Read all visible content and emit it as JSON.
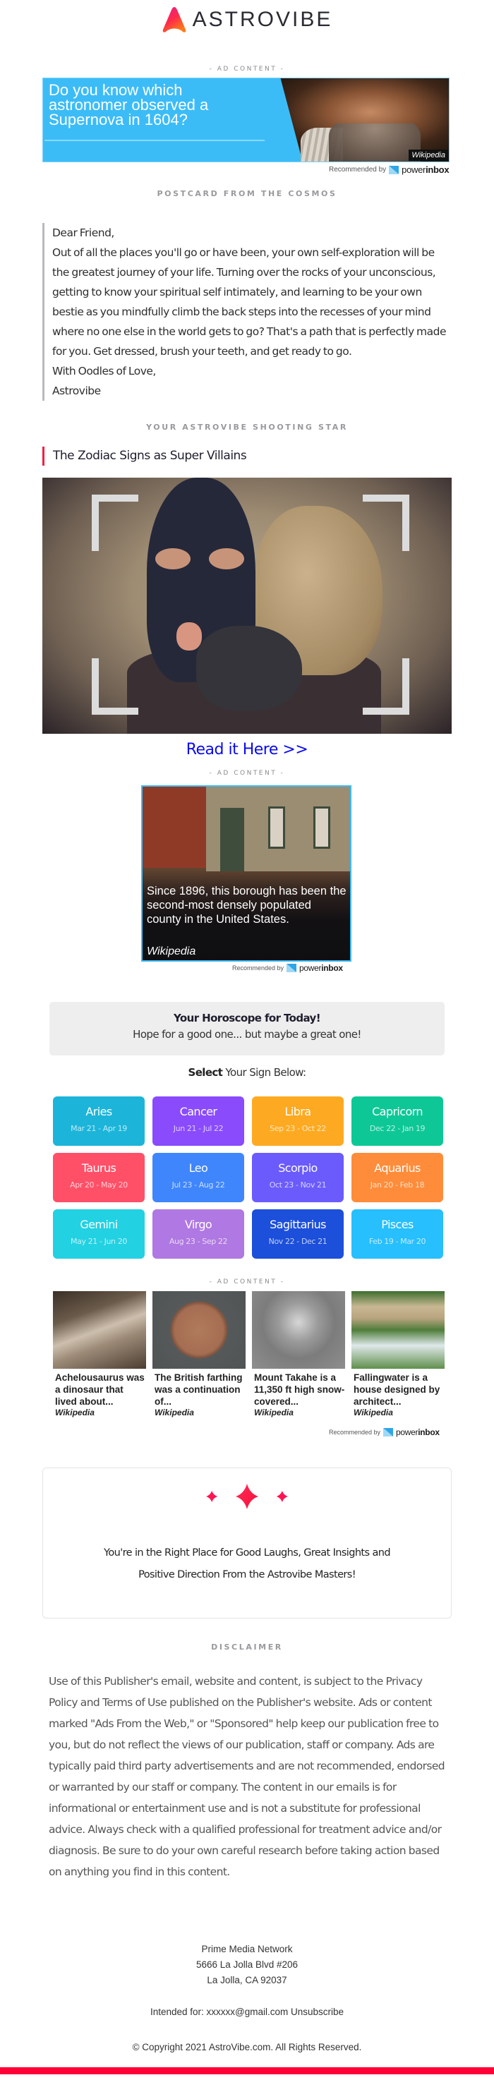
{
  "brand": {
    "name": "ASTROVIBE",
    "logo_icon": "astrovibe-peak-logo",
    "accent_color": "#ff0037"
  },
  "ads": {
    "label": "- AD CONTENT -",
    "recommended_by": "Recommended by",
    "powerinbox_prefix": "power",
    "powerinbox_suffix": "inbox",
    "top_ad": {
      "text": "Do you know which astronomer observed a Supernova in 1604?",
      "source": "Wikipedia",
      "bg_color": "#3cbcf7"
    },
    "middle_ad": {
      "text": "Since 1896, this borough has been the second-most densely populated county in the United States.",
      "source": "Wikipedia"
    },
    "row_ads": [
      {
        "title": "Achelousaurus was a dinosaur that lived about...",
        "source": "Wikipedia"
      },
      {
        "title": "The British farthing was a continuation of...",
        "source": "Wikipedia"
      },
      {
        "title": "Mount Takahe is a 11,350 ft high snow-covered...",
        "source": "Wikipedia"
      },
      {
        "title": "Fallingwater is a house designed by architect...",
        "source": "Wikipedia"
      }
    ]
  },
  "postcard": {
    "section_title": "POSTCARD FROM THE COSMOS",
    "greeting": "Dear Friend,",
    "body": "Out of all the places you'll go or have been, your own self-exploration will be the greatest journey of your life. Turning over the rocks of your unconscious, getting to know your spiritual self intimately, and learning to be your own bestie as you mindfully climb the back steps into the recesses of your mind where no one else in the world gets to go? That's a path that is perfectly made for you. Get dressed, brush your teeth, and get ready to go.",
    "signoff": "With Oodles of Love,",
    "signature": "Astrovibe"
  },
  "shooting_star": {
    "section_title": "YOUR ASTROVIBE SHOOTING STAR",
    "headline": "The Zodiac Signs as Super Villains",
    "link_label": "Read it Here >>"
  },
  "horoscope": {
    "title": "Your Horoscope for Today!",
    "subtitle": "Hope for a good one... but maybe a great one!",
    "select_bold": "Select",
    "select_rest": " Your Sign Below:",
    "signs": [
      {
        "name": "Aries",
        "dates": "Mar 21 - Apr 19",
        "color": "#1cb5d9"
      },
      {
        "name": "Cancer",
        "dates": "Jun 21 - Jul 22",
        "color": "#8a4bfc"
      },
      {
        "name": "Libra",
        "dates": "Sep 23 - Oct 22",
        "color": "#fdaa22"
      },
      {
        "name": "Capricorn",
        "dates": "Dec 22 - Jan 19",
        "color": "#0dc896"
      },
      {
        "name": "Taurus",
        "dates": "Apr 20 - May 20",
        "color": "#ff5068"
      },
      {
        "name": "Leo",
        "dates": "Jul 23 - Aug 22",
        "color": "#3f86fd"
      },
      {
        "name": "Scorpio",
        "dates": "Oct 23 - Nov 21",
        "color": "#6b5bfc"
      },
      {
        "name": "Aquarius",
        "dates": "Jan 20 - Feb 18",
        "color": "#ff8c3a"
      },
      {
        "name": "Gemini",
        "dates": "May 21 - Jun 20",
        "color": "#22d1e2"
      },
      {
        "name": "Virgo",
        "dates": "Aug 23 - Sep 22",
        "color": "#b078e2"
      },
      {
        "name": "Sagittarius",
        "dates": "Nov 22 - Dec 21",
        "color": "#1c4fda"
      },
      {
        "name": "Pisces",
        "dates": "Feb 19 - Mar 20",
        "color": "#27bffd"
      }
    ]
  },
  "tagline": {
    "icon": "sparkle-stars",
    "line1": "You're in the Right Place for Good Laughs, Great Insights and",
    "line2": "Positive Direction From the Astrovibe Masters!"
  },
  "disclaimer": {
    "title": "DISCLAIMER",
    "text": "Use of this Publisher's email, website and content, is subject to the Privacy Policy and Terms of Use published on the Publisher's website. Ads or content marked \"Ads From the Web,\" or \"Sponsored\" help keep our publication free to you, but do not reflect the views of our publication, staff or company. Ads are typically paid third party advertisements and are not recommended, endorsed or warranted by our staff or company. The content in our emails is for informational or entertainment use and is not a substitute for professional advice. Always check with a qualified professional for treatment advice and/or diagnosis. Be sure to do your own careful research before taking action based on anything you find in this content."
  },
  "footer": {
    "company": "Prime Media Network",
    "address1": "5666 La Jolla Blvd #206",
    "address2": "La Jolla, CA 92037",
    "intended_label": "Intended for:",
    "email": "xxxxxx@gmail.com",
    "unsubscribe": "Unsubscribe",
    "copyright": "© Copyright 2021 AstroVibe.com. All Rights Reserved."
  }
}
